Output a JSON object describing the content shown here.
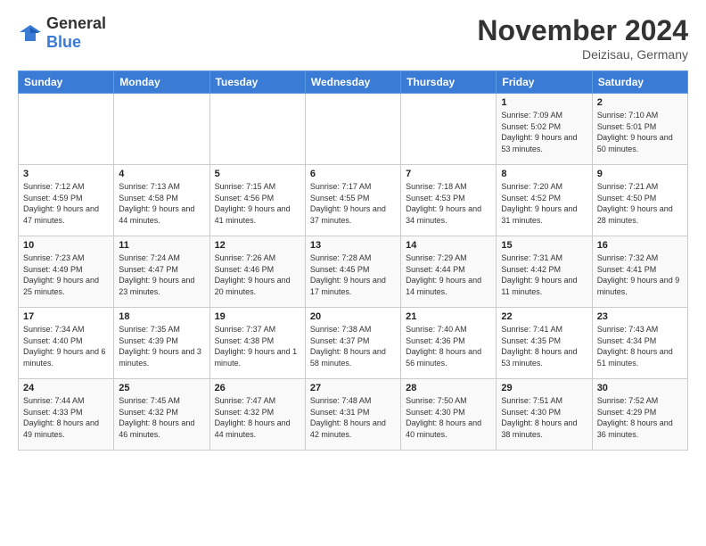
{
  "header": {
    "logo_general": "General",
    "logo_blue": "Blue",
    "title": "November 2024",
    "location": "Deizisau, Germany"
  },
  "days_of_week": [
    "Sunday",
    "Monday",
    "Tuesday",
    "Wednesday",
    "Thursday",
    "Friday",
    "Saturday"
  ],
  "weeks": [
    [
      {
        "day": "",
        "info": ""
      },
      {
        "day": "",
        "info": ""
      },
      {
        "day": "",
        "info": ""
      },
      {
        "day": "",
        "info": ""
      },
      {
        "day": "",
        "info": ""
      },
      {
        "day": "1",
        "info": "Sunrise: 7:09 AM\nSunset: 5:02 PM\nDaylight: 9 hours and 53 minutes."
      },
      {
        "day": "2",
        "info": "Sunrise: 7:10 AM\nSunset: 5:01 PM\nDaylight: 9 hours and 50 minutes."
      }
    ],
    [
      {
        "day": "3",
        "info": "Sunrise: 7:12 AM\nSunset: 4:59 PM\nDaylight: 9 hours and 47 minutes."
      },
      {
        "day": "4",
        "info": "Sunrise: 7:13 AM\nSunset: 4:58 PM\nDaylight: 9 hours and 44 minutes."
      },
      {
        "day": "5",
        "info": "Sunrise: 7:15 AM\nSunset: 4:56 PM\nDaylight: 9 hours and 41 minutes."
      },
      {
        "day": "6",
        "info": "Sunrise: 7:17 AM\nSunset: 4:55 PM\nDaylight: 9 hours and 37 minutes."
      },
      {
        "day": "7",
        "info": "Sunrise: 7:18 AM\nSunset: 4:53 PM\nDaylight: 9 hours and 34 minutes."
      },
      {
        "day": "8",
        "info": "Sunrise: 7:20 AM\nSunset: 4:52 PM\nDaylight: 9 hours and 31 minutes."
      },
      {
        "day": "9",
        "info": "Sunrise: 7:21 AM\nSunset: 4:50 PM\nDaylight: 9 hours and 28 minutes."
      }
    ],
    [
      {
        "day": "10",
        "info": "Sunrise: 7:23 AM\nSunset: 4:49 PM\nDaylight: 9 hours and 25 minutes."
      },
      {
        "day": "11",
        "info": "Sunrise: 7:24 AM\nSunset: 4:47 PM\nDaylight: 9 hours and 23 minutes."
      },
      {
        "day": "12",
        "info": "Sunrise: 7:26 AM\nSunset: 4:46 PM\nDaylight: 9 hours and 20 minutes."
      },
      {
        "day": "13",
        "info": "Sunrise: 7:28 AM\nSunset: 4:45 PM\nDaylight: 9 hours and 17 minutes."
      },
      {
        "day": "14",
        "info": "Sunrise: 7:29 AM\nSunset: 4:44 PM\nDaylight: 9 hours and 14 minutes."
      },
      {
        "day": "15",
        "info": "Sunrise: 7:31 AM\nSunset: 4:42 PM\nDaylight: 9 hours and 11 minutes."
      },
      {
        "day": "16",
        "info": "Sunrise: 7:32 AM\nSunset: 4:41 PM\nDaylight: 9 hours and 9 minutes."
      }
    ],
    [
      {
        "day": "17",
        "info": "Sunrise: 7:34 AM\nSunset: 4:40 PM\nDaylight: 9 hours and 6 minutes."
      },
      {
        "day": "18",
        "info": "Sunrise: 7:35 AM\nSunset: 4:39 PM\nDaylight: 9 hours and 3 minutes."
      },
      {
        "day": "19",
        "info": "Sunrise: 7:37 AM\nSunset: 4:38 PM\nDaylight: 9 hours and 1 minute."
      },
      {
        "day": "20",
        "info": "Sunrise: 7:38 AM\nSunset: 4:37 PM\nDaylight: 8 hours and 58 minutes."
      },
      {
        "day": "21",
        "info": "Sunrise: 7:40 AM\nSunset: 4:36 PM\nDaylight: 8 hours and 56 minutes."
      },
      {
        "day": "22",
        "info": "Sunrise: 7:41 AM\nSunset: 4:35 PM\nDaylight: 8 hours and 53 minutes."
      },
      {
        "day": "23",
        "info": "Sunrise: 7:43 AM\nSunset: 4:34 PM\nDaylight: 8 hours and 51 minutes."
      }
    ],
    [
      {
        "day": "24",
        "info": "Sunrise: 7:44 AM\nSunset: 4:33 PM\nDaylight: 8 hours and 49 minutes."
      },
      {
        "day": "25",
        "info": "Sunrise: 7:45 AM\nSunset: 4:32 PM\nDaylight: 8 hours and 46 minutes."
      },
      {
        "day": "26",
        "info": "Sunrise: 7:47 AM\nSunset: 4:32 PM\nDaylight: 8 hours and 44 minutes."
      },
      {
        "day": "27",
        "info": "Sunrise: 7:48 AM\nSunset: 4:31 PM\nDaylight: 8 hours and 42 minutes."
      },
      {
        "day": "28",
        "info": "Sunrise: 7:50 AM\nSunset: 4:30 PM\nDaylight: 8 hours and 40 minutes."
      },
      {
        "day": "29",
        "info": "Sunrise: 7:51 AM\nSunset: 4:30 PM\nDaylight: 8 hours and 38 minutes."
      },
      {
        "day": "30",
        "info": "Sunrise: 7:52 AM\nSunset: 4:29 PM\nDaylight: 8 hours and 36 minutes."
      }
    ]
  ]
}
